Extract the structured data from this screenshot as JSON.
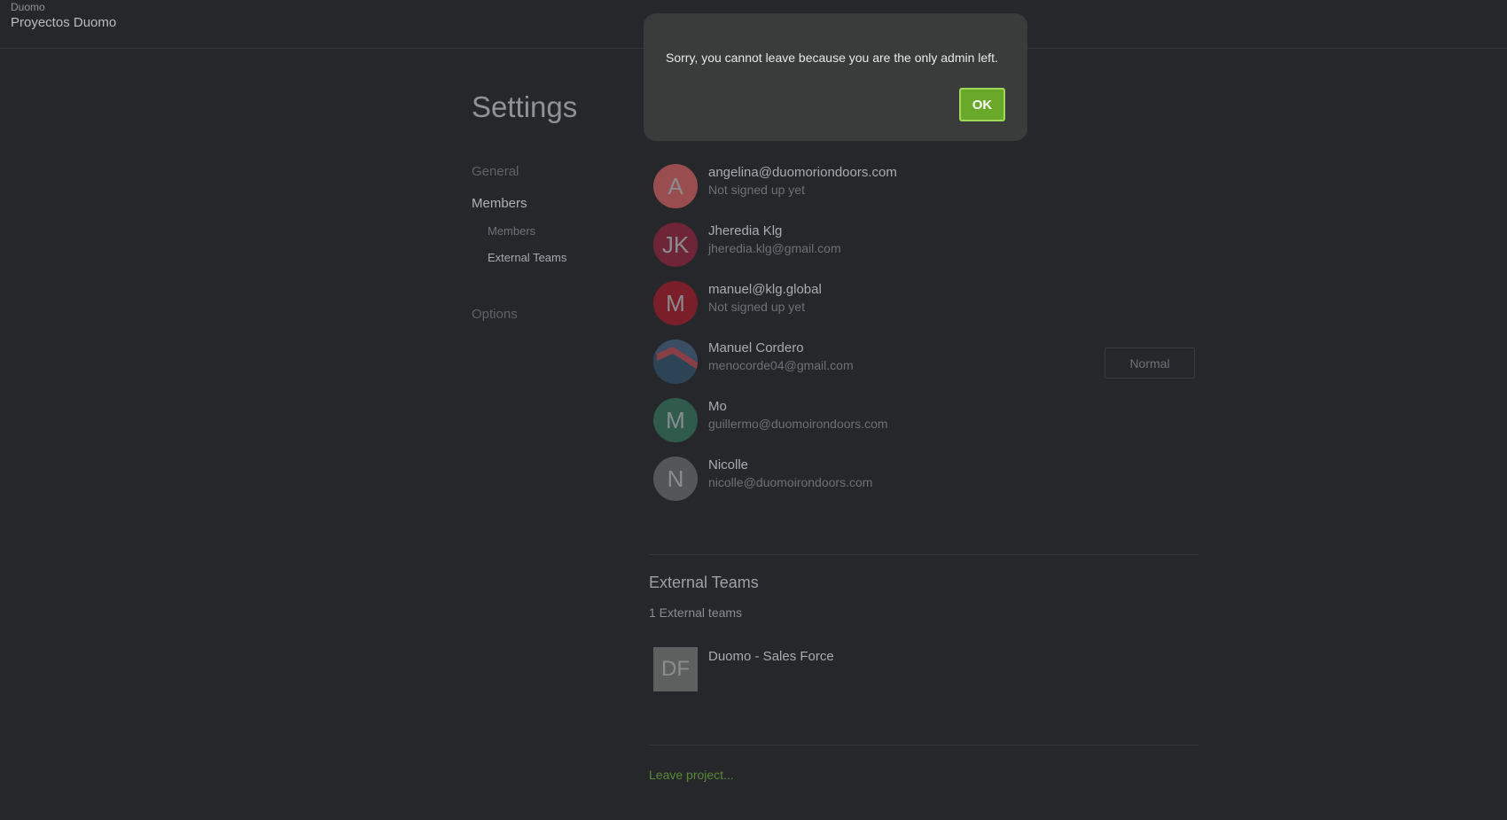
{
  "header": {
    "org": "Duomo",
    "project": "Proyectos Duomo"
  },
  "page": {
    "title": "Settings"
  },
  "nav": {
    "general": "General",
    "members": "Members",
    "members_sub": "Members",
    "external_teams": "External Teams",
    "options": "Options"
  },
  "members": [
    {
      "initials": "A",
      "name": "angelina@duomoriondoors.com",
      "sub": "Not signed up yet",
      "color": "#9a4d4f"
    },
    {
      "initials": "JK",
      "name": "Jheredia Klg",
      "sub": "jheredia.klg@gmail.com",
      "color": "#6e2537"
    },
    {
      "initials": "M",
      "name": "manuel@klg.global",
      "sub": "Not signed up yet",
      "color": "#7a1f29"
    },
    {
      "initials": "",
      "name": "Manuel Cordero",
      "sub": "menocorde04@gmail.com",
      "color": "#2f4a5c"
    },
    {
      "initials": "M",
      "name": "Mo",
      "sub": "guillermo@duomoirondoors.com",
      "color": "#2f5a4c"
    },
    {
      "initials": "N",
      "name": "Nicolle",
      "sub": "nicolle@duomoirondoors.com",
      "color": "#545659"
    }
  ],
  "role_button": "Normal",
  "external": {
    "title": "External Teams",
    "count": "1 External teams",
    "team": {
      "initials": "DF",
      "name": "Duomo - Sales Force"
    }
  },
  "leave_link": "Leave project...",
  "dialog": {
    "message": "Sorry, you cannot leave because you are the only admin left.",
    "ok": "OK"
  }
}
